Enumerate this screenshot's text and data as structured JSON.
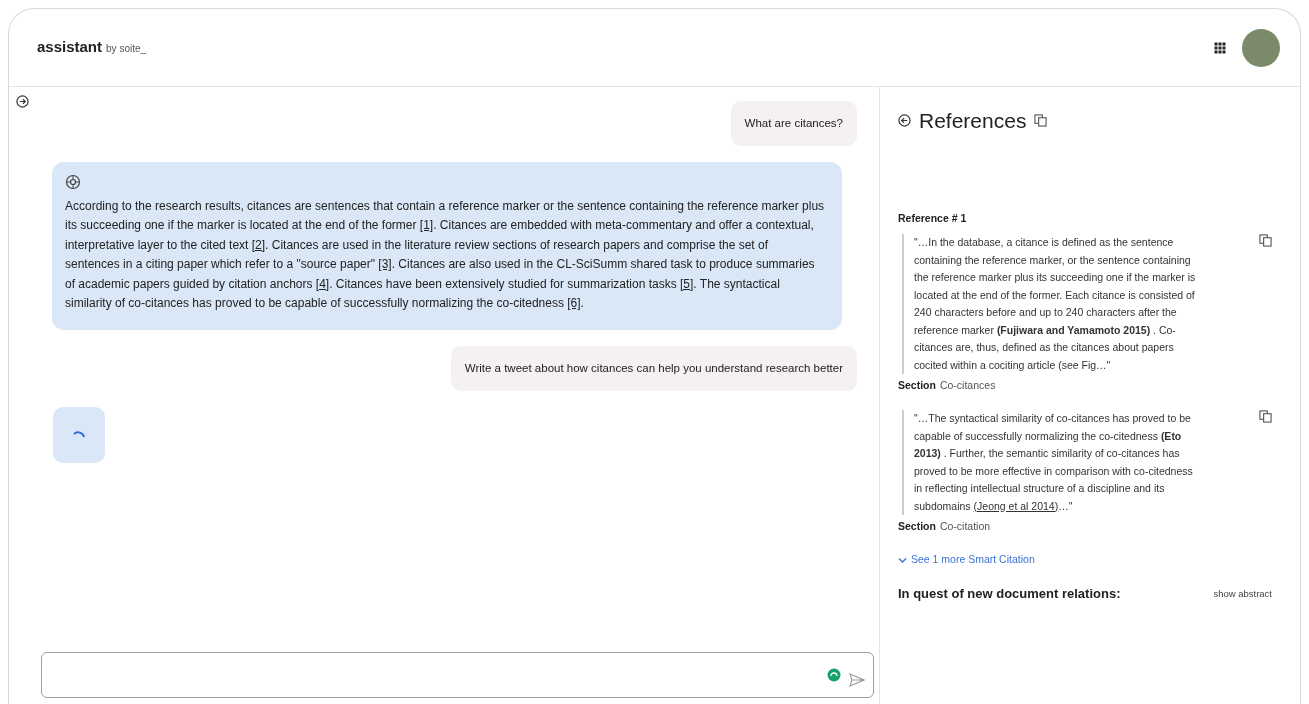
{
  "header": {
    "title": "assistant",
    "byline": "by soite_"
  },
  "chat": {
    "messages": [
      {
        "kind": "user",
        "text": "What are citances?"
      },
      {
        "kind": "assistant",
        "segments": [
          {
            "kind": "text",
            "text": "According to the research results, citances are sentences that contain a reference marker or the sentence containing the reference marker plus its succeeding one if the marker is located at the end of the former "
          },
          {
            "kind": "cite",
            "text": "[1]"
          },
          {
            "kind": "text",
            "text": ". Citances are embedded with meta-commentary and offer a contextual, interpretative layer to the cited text "
          },
          {
            "kind": "cite",
            "text": "[2]"
          },
          {
            "kind": "text",
            "text": ". Citances are used in the literature review sections of research papers and comprise the set of sentences in a citing paper which refer to a \"source paper\" "
          },
          {
            "kind": "cite",
            "text": "[3]"
          },
          {
            "kind": "text",
            "text": ". Citances are also used in the CL-SciSumm shared task to produce summaries of academic papers guided by citation anchors "
          },
          {
            "kind": "cite",
            "text": "[4]"
          },
          {
            "kind": "text",
            "text": ". Citances have been extensively studied for summarization tasks "
          },
          {
            "kind": "cite",
            "text": "[5]"
          },
          {
            "kind": "text",
            "text": ". The syntactical similarity of co-citances has proved to be capable of successfully normalizing the co-citedness "
          },
          {
            "kind": "cite",
            "text": "[6]"
          },
          {
            "kind": "text",
            "text": "."
          }
        ]
      },
      {
        "kind": "user",
        "text": "Write a tweet about how citances can help you understand research better"
      },
      {
        "kind": "loading"
      }
    ]
  },
  "references": {
    "title": "References",
    "items": [
      {
        "heading": "Reference # 1",
        "quotes": [
          {
            "segments": [
              {
                "kind": "text",
                "text": "\"…In the database, a citance is defined as the sentence containing the reference marker, or the sentence containing the reference marker plus its succeeding one if the marker is located at the end of the former. Each citance is consisted of 240 characters before and up to 240 characters after the reference marker "
              },
              {
                "kind": "bold",
                "text": "(Fujiwara and Yamamoto 2015)"
              },
              {
                "kind": "text",
                "text": " . Co-citances are, thus, defined as the citances about papers cocited within a cociting article (see Fig…\""
              }
            ],
            "section_label": "Section",
            "section": "Co-citances"
          },
          {
            "segments": [
              {
                "kind": "text",
                "text": "\"…The syntactical similarity of co-citances has proved to be capable of successfully normalizing the co-citedness "
              },
              {
                "kind": "bold",
                "text": "(Eto 2013)"
              },
              {
                "kind": "text",
                "text": " . Further, the semantic similarity of co-citances has proved to be more effective in comparison with co-citedness in reflecting intellectual structure of a discipline and its subdomains "
              },
              {
                "kind": "link",
                "text": "(Jeong et al 2014)"
              },
              {
                "kind": "text",
                "text": "…\""
              }
            ],
            "section_label": "Section",
            "section": "Co-citation"
          }
        ],
        "more": "See 1 more Smart Citation"
      }
    ],
    "next_title": "In quest of new document relations:",
    "next_action": "show abstract"
  }
}
